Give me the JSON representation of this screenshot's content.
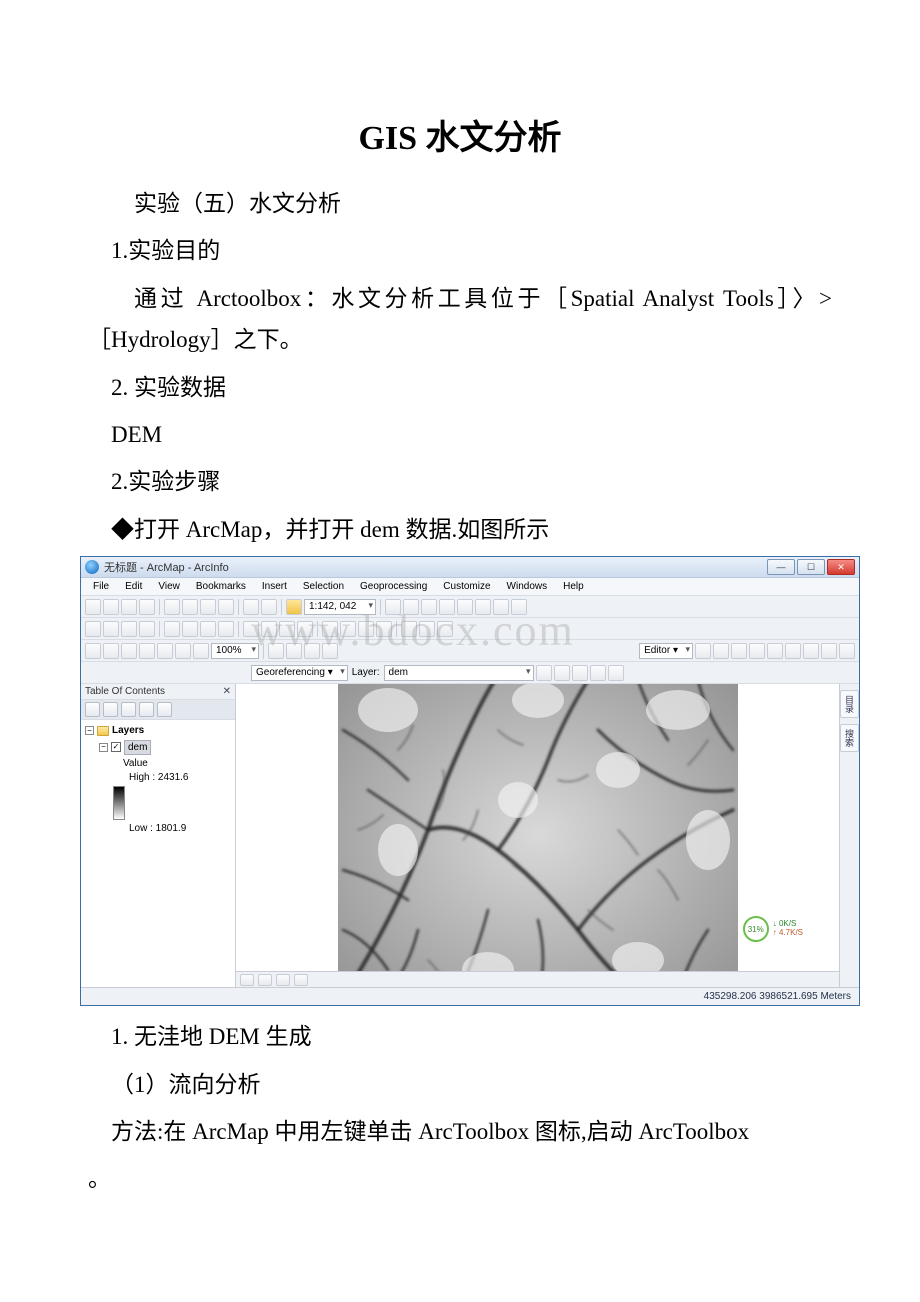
{
  "doc": {
    "title": "GIS 水文分析",
    "p1": " 实验（五）水文分析",
    "p2": "1.实验目的",
    "p3_a": " 通过 Arctoolbox：水文分析工具位于［Spatial Analyst Tools］〉>［Hydrology］之下。",
    "p4": "2. 实验数据",
    "p5": " DEM",
    "p6": "2.实验步骤",
    "p7": "◆打开 ArcMap，并打开 dem 数据.如图所示",
    "p8": "1. 无洼地 DEM 生成",
    "p9": "（1）流向分析",
    "p10": "方法:在 ArcMap 中用左键单击 ArcToolbox 图标,启动 ArcToolbox",
    "p11": "。"
  },
  "watermark": "www.bdocx.com",
  "app": {
    "title": "无标题 - ArcMap - ArcInfo",
    "menus": [
      "File",
      "Edit",
      "View",
      "Bookmarks",
      "Insert",
      "Selection",
      "Geoprocessing",
      "Customize",
      "Windows",
      "Help"
    ],
    "scale": "1:142, 042",
    "zoom": "100%",
    "georef_label": "Georeferencing ▾",
    "georef_layer_label": "Layer:",
    "georef_layer": "dem",
    "editor_label": "Editor ▾",
    "toc_title": "Table Of Contents",
    "toc_pin": "✕",
    "layer_group": "Layers",
    "layer_name": "dem",
    "value_label": "Value",
    "high_label": "High : 2431.6",
    "low_label": "Low : 1801.9",
    "right_tab1": "目录",
    "right_tab2": "搜索",
    "badge_pct": "31%",
    "badge_l1": "0K/S",
    "badge_l2": "4.7K/S",
    "status_coords": "435298.206 3986521.695 Meters"
  }
}
